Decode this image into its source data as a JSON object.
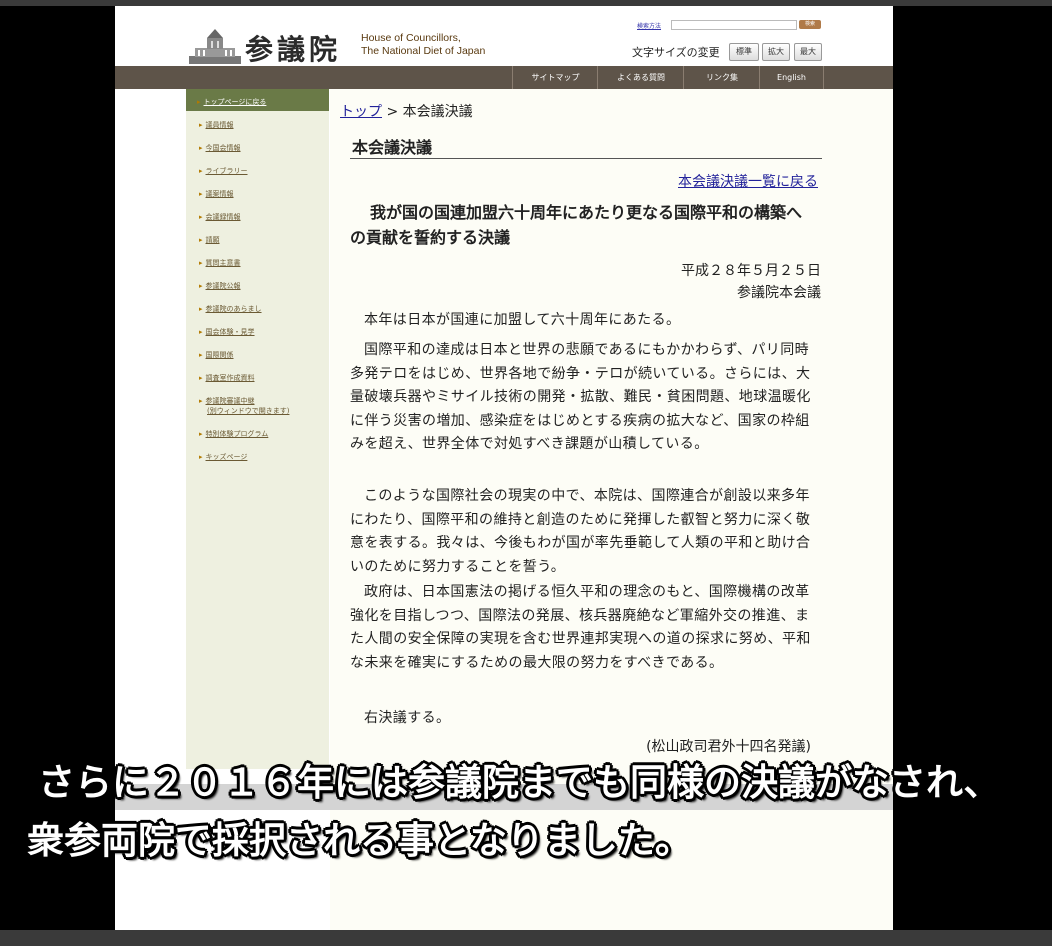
{
  "header": {
    "logo_jp": "参議院",
    "logo_en_line1": "House of Councillors,",
    "logo_en_line2": "The National Diet of Japan",
    "search_link": "検索方法",
    "search_button": "検索",
    "fontsize_label": "文字サイズの変更",
    "fontsize_buttons": [
      "標準",
      "拡大",
      "最大"
    ]
  },
  "nav": {
    "items": [
      "サイトマップ",
      "よくある質問",
      "リンク集",
      "English"
    ]
  },
  "sidebar": {
    "items": [
      "トップページに戻る",
      "議員情報",
      "今国会情報",
      "ライブラリー",
      "議案情報",
      "会議録情報",
      "請願",
      "質問主意書",
      "参議院公報",
      "参議院のあらまし",
      "国会体験・見学",
      "国際関係",
      "調査室作成資料",
      "参議院審議中継",
      "特別体験プログラム",
      "キッズページ"
    ],
    "broadcast_sub": "(別ウィンドウで開きます)"
  },
  "breadcrumb": {
    "top": "トップ",
    "sep": " > ",
    "current": "本会議決議"
  },
  "content": {
    "page_title": "本会議決議",
    "back_link": "本会議決議一覧に戻る",
    "resolution_title": "我が国の国連加盟六十周年にあたり更なる国際平和の構築への貢献を誓約する決議",
    "date": "平成２８年５月２５日",
    "adopted_by": "参議院本会議",
    "paragraphs": [
      "本年は日本が国連に加盟して六十周年にあたる。",
      "国際平和の達成は日本と世界の悲願であるにもかかわらず、パリ同時多発テロをはじめ、世界各地で紛争・テロが続いている。さらには、大量破壊兵器やミサイル技術の開発・拡散、難民・貧困問題、地球温暖化に伴う災害の増加、感染症をはじめとする疾病の拡大など、国家の枠組みを超え、世界全体で対処すべき課題が山積している。",
      "このような国際社会の現実の中で、本院は、国際連合が創設以来多年にわたり、国際平和の維持と創造のために発揮した叡智と努力に深く敬意を表する。我々は、今後もわが国が率先垂範して人類の平和と助け合いのために努力することを誓う。",
      "政府は、日本国憲法の掲げる恒久平和の理念のもと、国際機構の改革強化を目指しつつ、国際法の発展、核兵器廃絶など軍縮外交の推進、また人間の安全保障の実現を含む世界連邦実現への道の探求に努め、平和な未来を確実にするための最大限の努力をすべきである。",
      "右決議する。"
    ],
    "proposer": "(松山政司君外十四名発議)"
  },
  "subtitles": {
    "line1": "さらに２０１６年には参議院までも同様の決議がなされ、",
    "line2": "衆参両院で採択される事となりました。"
  },
  "colors": {
    "nav_bg": "#5e5449",
    "sidebar_bg": "#eef0e0",
    "sidebar_active": "#6a7a47",
    "link": "#22229a"
  }
}
